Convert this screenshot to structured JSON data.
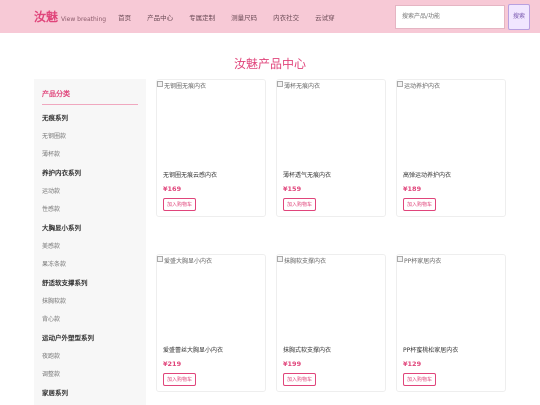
{
  "header": {
    "brand_name": "汝魅",
    "brand_sub": "View breathing",
    "nav": [
      "首页",
      "产品中心",
      "专属定制",
      "测量尺码",
      "内衣社交",
      "云试穿"
    ],
    "search_placeholder": "搜索产品/功能",
    "search_button": "搜索"
  },
  "page_title": "汝魅产品中心",
  "sidebar": {
    "title": "产品分类",
    "groups": [
      {
        "name": "无痕系列",
        "items": [
          "无钢圈款",
          "薄杯款"
        ]
      },
      {
        "name": "养护内衣系列",
        "items": [
          "运动款",
          "性感款"
        ]
      },
      {
        "name": "大胸显小系列",
        "items": [
          "美感款",
          "果冻条款"
        ]
      },
      {
        "name": "舒适软支撑系列",
        "items": [
          "抹胸软款",
          "背心款"
        ]
      },
      {
        "name": "运动户外塑型系列",
        "items": [
          "夜跑款",
          "调整款"
        ]
      },
      {
        "name": "家居系列",
        "items": []
      }
    ]
  },
  "products": [
    {
      "img_alt": "无钢圈无痕内衣",
      "name": "无钢圈无痕云感内衣",
      "price": "¥169",
      "cart": "加入购物车"
    },
    {
      "img_alt": "薄杯无痕内衣",
      "name": "薄杯透气无痕内衣",
      "price": "¥159",
      "cart": "加入购物车"
    },
    {
      "img_alt": "运动养护内衣",
      "name": "高弹运动养护内衣",
      "price": "¥189",
      "cart": "加入购物车"
    },
    {
      "img_alt": "爱盛大胸显小内衣",
      "name": "爱盛蕾丝大胸显小内衣",
      "price": "¥219",
      "cart": "加入购物车"
    },
    {
      "img_alt": "抹胸软支撑内衣",
      "name": "抹胸式软支撑内衣",
      "price": "¥199",
      "cart": "加入购物车"
    },
    {
      "img_alt": "PP杯家居内衣",
      "name": "PP杯蜜桃松家居内衣",
      "price": "¥129",
      "cart": "加入购物车"
    }
  ],
  "colors": {
    "accent": "#e0457b",
    "header_bg": "#f7c9d6",
    "sidebar_bg": "#f7f7f7"
  }
}
